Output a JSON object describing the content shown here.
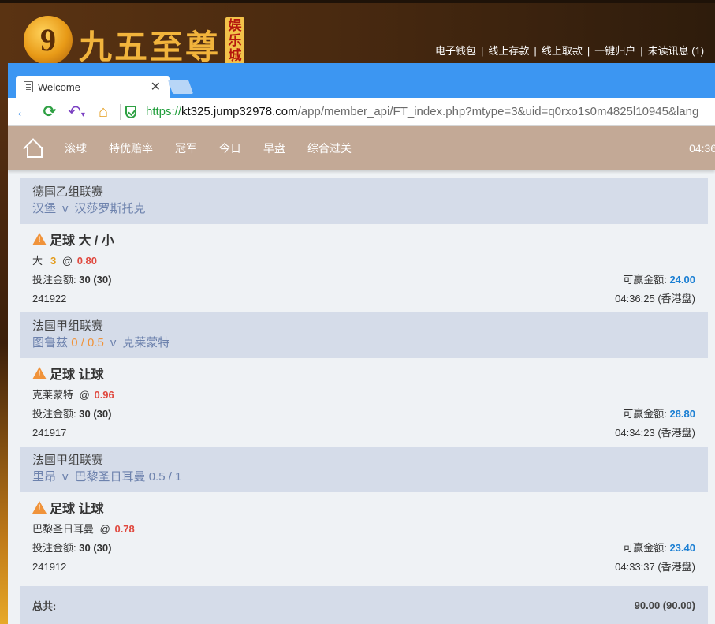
{
  "site": {
    "logo_text": "九五至尊",
    "logo_badge": "娱乐城",
    "links": [
      "电子钱包",
      "线上存款",
      "线上取款",
      "一键归户",
      "未读讯息 (1)"
    ]
  },
  "browser": {
    "tab_title": "Welcome",
    "url_scheme": "https://",
    "url_host": "kt325.jump32978.com",
    "url_path": "/app/member_api/FT_index.php?mtype=3&uid=q0rxo1s0m4825l10945&lang"
  },
  "appnav": {
    "items": [
      "滚球",
      "特优赔率",
      "冠军",
      "今日",
      "早盘",
      "综合过关"
    ],
    "time": "04:36:"
  },
  "bets": [
    {
      "league": "德国乙组联赛",
      "home": "汉堡",
      "home_handicap": "",
      "vs": "v",
      "away": "汉莎罗斯托克",
      "away_handicap": "",
      "bet_type": "足球 大 / 小",
      "pick": "大",
      "pick_line": "3",
      "at": "@",
      "odds": "0.80",
      "stake_label": "投注金额:",
      "stake": "30 (30)",
      "win_label": "可赢金额:",
      "win": "24.00",
      "ticket": "241922",
      "time": "04:36:25 (香港盘)"
    },
    {
      "league": "法国甲组联赛",
      "home": "图鲁兹",
      "home_handicap": "0 / 0.5",
      "vs": "v",
      "away": "克莱蒙特",
      "away_handicap": "",
      "bet_type": "足球 让球",
      "pick": "克莱蒙特",
      "pick_line": "",
      "at": "@",
      "odds": "0.96",
      "stake_label": "投注金额:",
      "stake": "30 (30)",
      "win_label": "可赢金额:",
      "win": "28.80",
      "ticket": "241917",
      "time": "04:34:23 (香港盘)"
    },
    {
      "league": "法国甲组联赛",
      "home": "里昂",
      "home_handicap": "",
      "vs": "v",
      "away": "巴黎圣日耳曼",
      "away_handicap": "0.5 / 1",
      "bet_type": "足球 让球",
      "pick": "巴黎圣日耳曼",
      "pick_line": "",
      "at": "@",
      "odds": "0.78",
      "stake_label": "投注金额:",
      "stake": "30 (30)",
      "win_label": "可赢金额:",
      "win": "23.40",
      "ticket": "241912",
      "time": "04:33:37 (香港盘)"
    }
  ],
  "total": {
    "label": "总共:",
    "value": "90.00 (90.00)"
  }
}
